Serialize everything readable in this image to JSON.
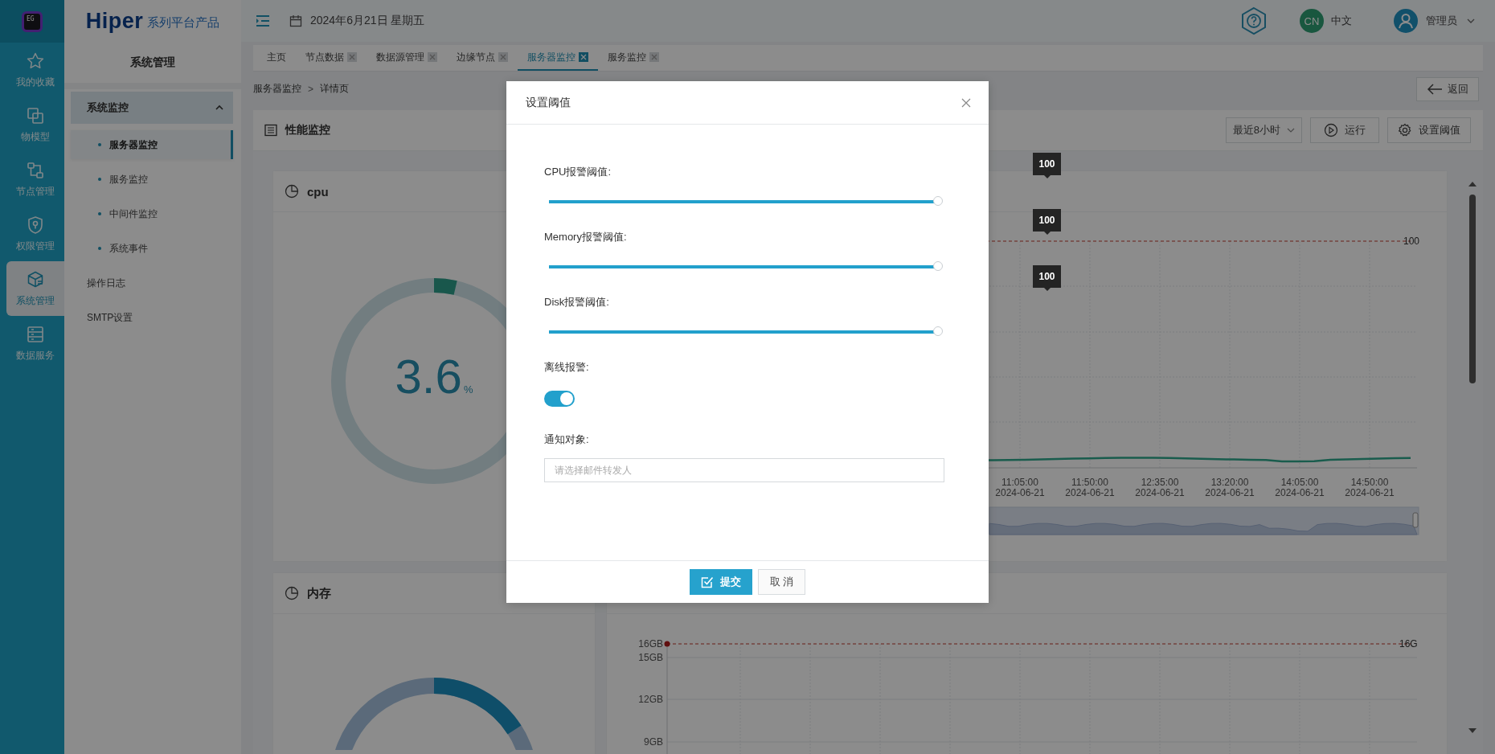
{
  "logo": {
    "badge": "EG",
    "brand": "Hiper",
    "tagline": "系列平台产品"
  },
  "rail": [
    {
      "label": "我的收藏",
      "selected": false
    },
    {
      "label": "物模型",
      "selected": false
    },
    {
      "label": "节点管理",
      "selected": false
    },
    {
      "label": "权限管理",
      "selected": false
    },
    {
      "label": "系统管理",
      "selected": true
    },
    {
      "label": "数据服务",
      "selected": false
    }
  ],
  "sidebar": {
    "title": "系统管理",
    "items": [
      {
        "label": "系统监控",
        "selected": false,
        "expanded": true,
        "children": [
          {
            "label": "服务器监控",
            "selected": true
          },
          {
            "label": "服务监控",
            "selected": false
          },
          {
            "label": "中间件监控",
            "selected": false
          },
          {
            "label": "系统事件",
            "selected": false
          }
        ]
      },
      {
        "label": "操作日志",
        "selected": false
      },
      {
        "label": "SMTP设置",
        "selected": false
      }
    ]
  },
  "header": {
    "date": "2024年6月21日 星期五",
    "language_badge": "CN",
    "language": "中文",
    "user": "管理员"
  },
  "tabs": [
    {
      "label": "主页",
      "closable": false,
      "selected": false
    },
    {
      "label": "节点数据",
      "closable": true,
      "selected": false
    },
    {
      "label": "数据源管理",
      "closable": true,
      "selected": false
    },
    {
      "label": "边缘节点",
      "closable": true,
      "selected": false
    },
    {
      "label": "服务器监控",
      "closable": true,
      "selected": true
    },
    {
      "label": "服务监控",
      "closable": true,
      "selected": false
    }
  ],
  "breadcrumb": {
    "items": [
      "服务器监控",
      "详情页"
    ],
    "separator": ">"
  },
  "back_button": "返回",
  "panel": {
    "title": "性能监控",
    "range": "最近8小时",
    "run_button": "运行",
    "threshold_button": "设置阈值"
  },
  "cpu_card": {
    "title": "cpu",
    "value": "3.6",
    "unit": "%",
    "level": 0.036
  },
  "cpu_chart": {
    "threshold_label": "100",
    "x_labels": [
      {
        "time": "11:05:00",
        "date": "2024-06-21"
      },
      {
        "time": "11:50:00",
        "date": "2024-06-21"
      },
      {
        "time": "12:35:00",
        "date": "2024-06-21"
      },
      {
        "time": "13:20:00",
        "date": "2024-06-21"
      },
      {
        "time": "14:05:00",
        "date": "2024-06-21"
      },
      {
        "time": "14:50:00",
        "date": "2024-06-21"
      }
    ]
  },
  "memory_card": {
    "title": "内存"
  },
  "memory_chart": {
    "threshold_label": "16G",
    "y_labels": [
      "16GB",
      "15GB",
      "12GB",
      "9GB"
    ]
  },
  "dialog": {
    "title": "设置阈值",
    "sliders": [
      {
        "label": "CPU报警阈值:",
        "level": 1,
        "tooltip": "100"
      },
      {
        "label": "Memory报警阈值:",
        "level": 1,
        "tooltip": "100"
      },
      {
        "label": "Disk报警阈值:",
        "level": 1,
        "tooltip": "100"
      }
    ],
    "offline_alarm": {
      "label": "离线报警:",
      "on": true
    },
    "notify": {
      "label": "通知对象:",
      "placeholder": "请选择邮件转发人"
    },
    "buttons": [
      {
        "label": "提交",
        "kind": "primary"
      },
      {
        "label": "取 消",
        "kind": "default"
      }
    ]
  }
}
